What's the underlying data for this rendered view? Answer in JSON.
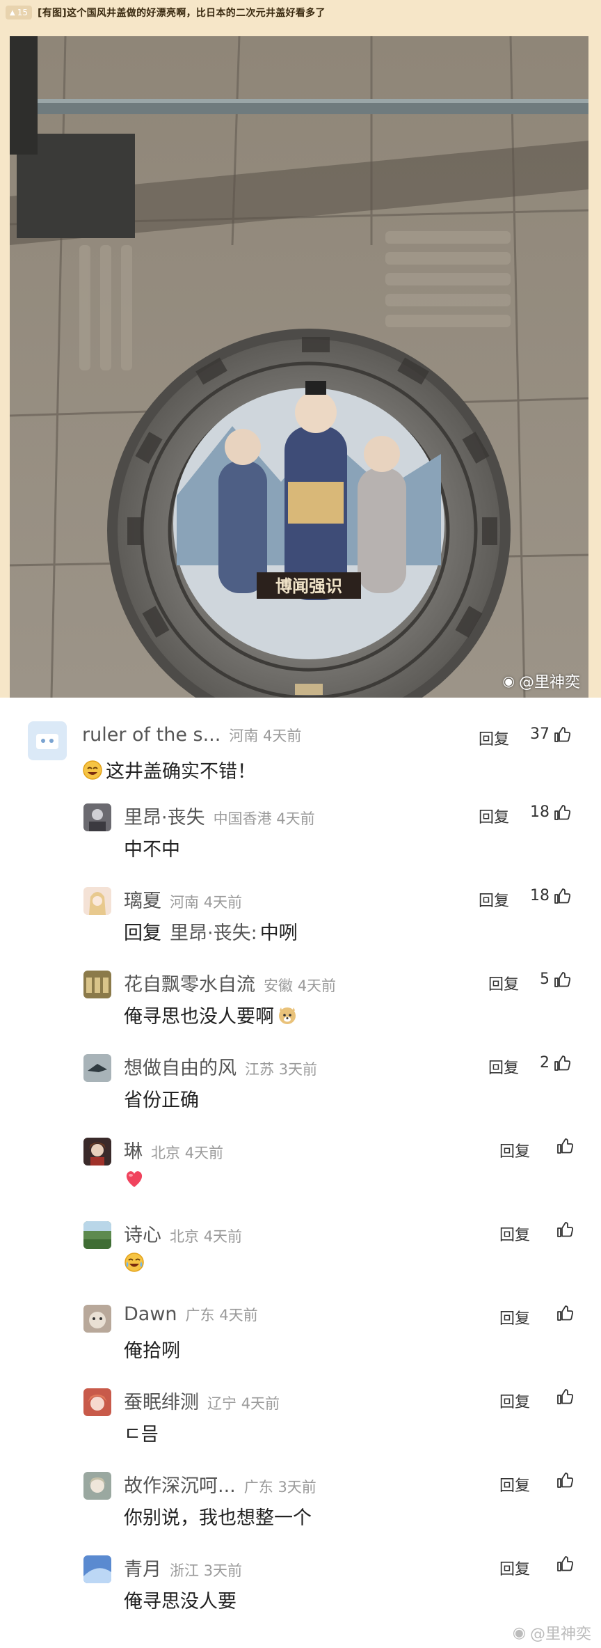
{
  "post": {
    "votes": "15",
    "title": "[有图]这个国风井盖做的好漂亮啊，比日本的二次元井盖好看多了"
  },
  "photo": {
    "banner_text": "博闻强识",
    "watermark": "@里神奕"
  },
  "comments": [
    {
      "user": "ruler of the s...",
      "location": "河南",
      "time": "4天前",
      "reply": "回复",
      "likes": "37",
      "text": "这井盖确实不错！",
      "emoji": "laugh-emoji",
      "avatar_color": "#dbe9f7"
    },
    {
      "user": "里昂·丧失",
      "location": "中国香港",
      "time": "4天前",
      "reply": "回复",
      "likes": "18",
      "text": "中不中",
      "avatar_color": "#6b6a70"
    },
    {
      "user": "璃夏",
      "location": "河南",
      "time": "4天前",
      "reply": "回复",
      "likes": "18",
      "reply_prefix": "回复",
      "reply_to": "里昂·丧失:",
      "text": "中咧",
      "avatar_color": "#f4e2d6"
    },
    {
      "user": "花自飘零水自流",
      "location": "安徽",
      "time": "4天前",
      "reply": "回复",
      "likes": "5",
      "text": "俺寻思也没人要啊",
      "emoji": "doge-emoji",
      "avatar_color": "#8b7a4a"
    },
    {
      "user": "想做自由的风",
      "location": "江苏",
      "time": "3天前",
      "reply": "回复",
      "likes": "2",
      "text": "省份正确",
      "avatar_color": "#a8b3b8"
    },
    {
      "user": "琳",
      "location": "北京",
      "time": "4天前",
      "reply": "回复",
      "likes": "",
      "text": "",
      "emoji": "heart-emoji",
      "avatar_color": "#3a2a2a"
    },
    {
      "user": "诗心",
      "location": "北京",
      "time": "4天前",
      "reply": "回复",
      "likes": "",
      "text": "",
      "emoji": "cry-laugh-emoji",
      "avatar_color": "#5d8a4e"
    },
    {
      "user": "Dawn",
      "location": "广东",
      "time": "4天前",
      "reply": "回复",
      "likes": "",
      "text": "俺拾咧",
      "avatar_color": "#b8a89a"
    },
    {
      "user": "蚕眠绯测",
      "location": "辽宁",
      "time": "4天前",
      "reply": "回复",
      "likes": "",
      "text": "ㄷ믐",
      "avatar_color": "#c85a4a"
    },
    {
      "user": "故作深沉呵...",
      "location": "广东",
      "time": "3天前",
      "reply": "回复",
      "likes": "",
      "text": "你别说，我也想整一个",
      "avatar_color": "#9aa8a0"
    },
    {
      "user": "青月",
      "location": "浙江",
      "time": "3天前",
      "reply": "回复",
      "likes": "",
      "text": "俺寻思没人要",
      "avatar_color": "#5a8ad0"
    }
  ],
  "footer": {
    "watermark": "@里神奕"
  }
}
